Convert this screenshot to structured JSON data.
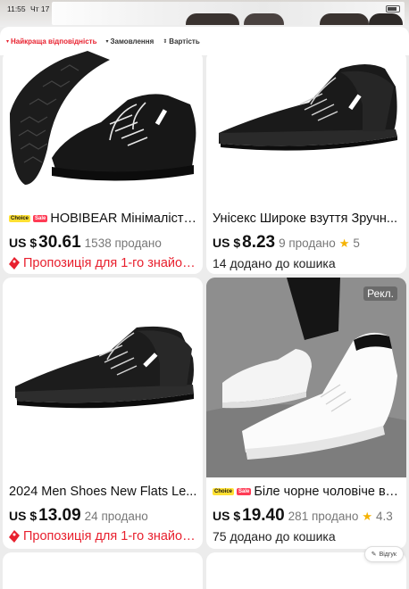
{
  "status_bar": {
    "time": "11:55",
    "day": "Чт 17"
  },
  "tabs": [
    {
      "label": "Найкраща відповідність",
      "active": true
    },
    {
      "label": "Замовлення",
      "active": false
    },
    {
      "label": "Вартість",
      "active": false
    }
  ],
  "products": [
    {
      "title": "HOBIBEAR Мінімалісти...",
      "choice_badge": "Choice",
      "sale_badge": "Sale",
      "currency": "US $",
      "price": "30.61",
      "sold": "1538 продано",
      "promo": "Пропозиція для 1-го знайом..."
    },
    {
      "title": "Унісекс Широке взуття Зручн...",
      "currency": "US $",
      "price": "8.23",
      "sold": "9 продано",
      "rating": "5",
      "cart": "14 додано до кошика"
    },
    {
      "title": "2024 Men Shoes New Flats Le...",
      "currency": "US $",
      "price": "13.09",
      "sold": "24 продано",
      "promo": "Пропозиція для 1-го знайом..."
    },
    {
      "title": "Біле чорне чоловіче взу...",
      "choice_badge": "Choice",
      "sale_badge": "Sale",
      "currency": "US $",
      "price": "19.40",
      "sold": "281 продано",
      "rating": "4.3",
      "cart": "75 додано до кошика",
      "ad_label": "Рекл."
    }
  ],
  "feedback_label": "Відгук",
  "colors": {
    "accent": "#e8202e",
    "star": "#f5b200",
    "choice": "#ffe033",
    "sale": "#ff3b55"
  }
}
